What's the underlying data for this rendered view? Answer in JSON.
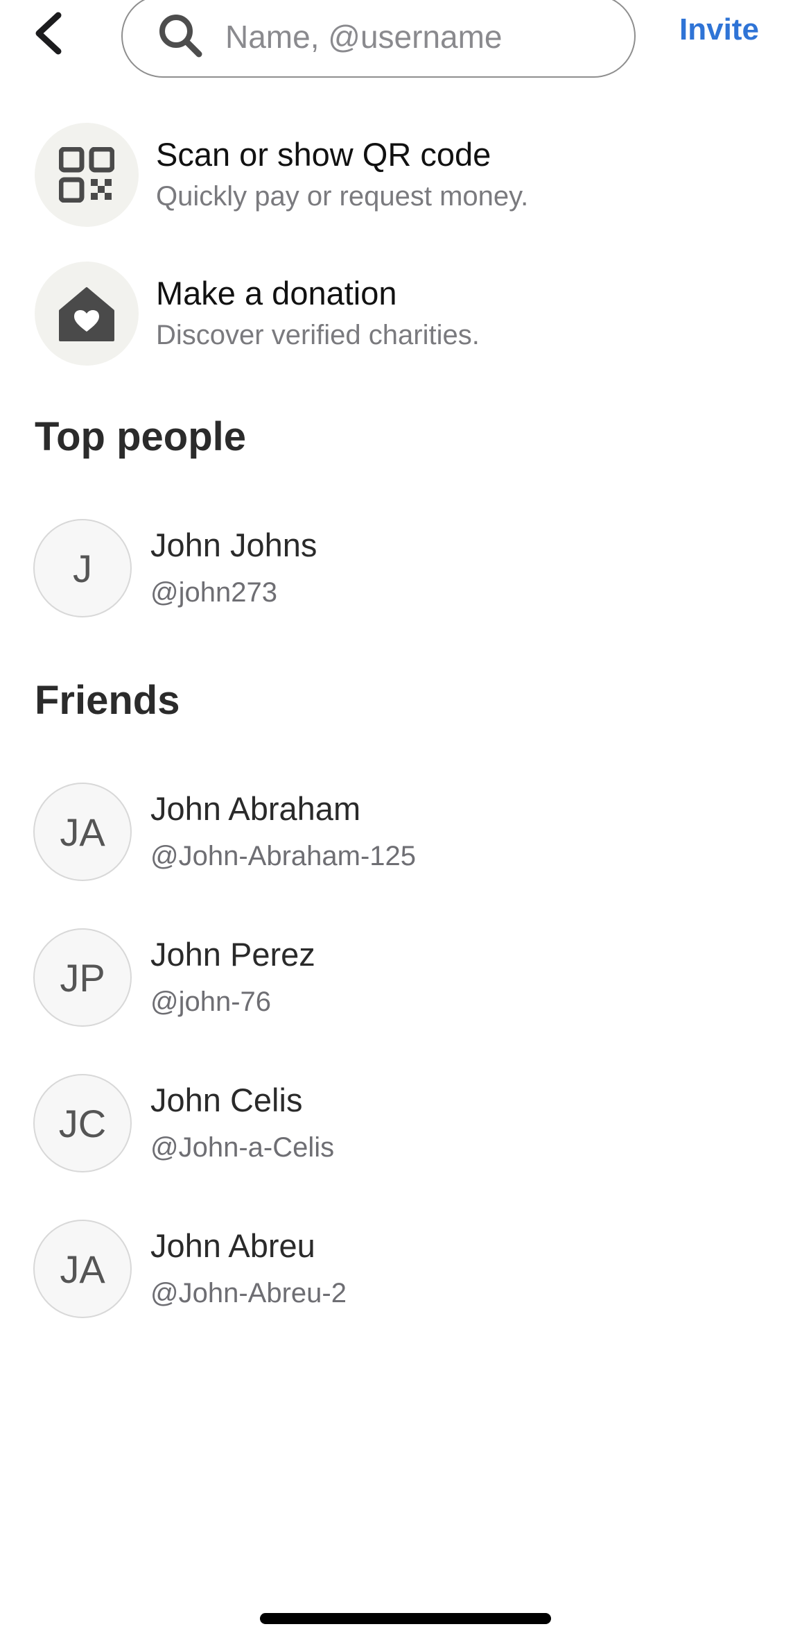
{
  "header": {
    "search_placeholder": "Name, @username",
    "invite_label": "Invite"
  },
  "actions": [
    {
      "title": "Scan or show QR code",
      "subtitle": "Quickly pay or request money.",
      "icon": "qr-code-icon"
    },
    {
      "title": "Make a donation",
      "subtitle": "Discover verified charities.",
      "icon": "heart-house-icon"
    }
  ],
  "sections": {
    "top_people": "Top people",
    "friends": "Friends"
  },
  "top_people": [
    {
      "initials": "J",
      "name": "John Johns",
      "handle": "@john273"
    }
  ],
  "friends": [
    {
      "initials": "JA",
      "name": "John Abraham",
      "handle": "@John-Abraham-125"
    },
    {
      "initials": "JP",
      "name": "John Perez",
      "handle": "@john-76"
    },
    {
      "initials": "JC",
      "name": "John Celis",
      "handle": "@John-a-Celis"
    },
    {
      "initials": "JA",
      "name": "John Abreu",
      "handle": "@John-Abreu-2"
    }
  ],
  "colors": {
    "accent": "#2f74d6",
    "icon_dark": "#4a4a4a",
    "icon_bg": "#f2f2ee"
  }
}
